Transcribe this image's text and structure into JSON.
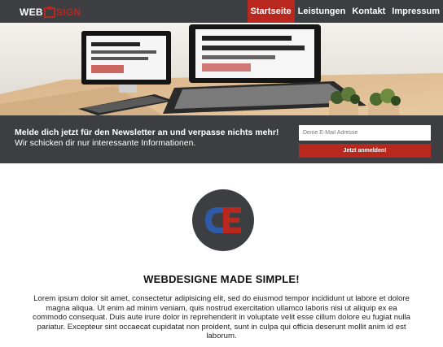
{
  "header": {
    "logo": {
      "left_text": "WEB",
      "right_text": "SIGN"
    },
    "nav": [
      {
        "label": "Startseite",
        "active": true
      },
      {
        "label": "Leistungen",
        "active": false
      },
      {
        "label": "Kontakt",
        "active": false
      },
      {
        "label": "Impressum",
        "active": false
      }
    ]
  },
  "hero": {
    "image": "desk-with-laptop-and-plants"
  },
  "newsletter": {
    "headline": "Melde dich jetzt für den Newsletter an und verpasse nichts mehr!",
    "subtext": " Wir schicken dir nur interessante Informationen.",
    "email_placeholder": "Deine E-Mail Adresse",
    "submit_label": "Jetzt anmelden!"
  },
  "content": {
    "headline": "WEBDESIGNE MADE SIMPLE!",
    "body": "Lorem ipsum dolor sit amet, consectetur adipisicing elit, sed do eiusmod tempor incididunt ut labore et dolore magna aliqua. Ut enim ad minim veniam, quis nostrud exercitation ullamco laboris nisi ut aliquip ex ea commodo consequat. Duis aute irure dolor in reprehenderit in voluptate velit esse cillum dolore eu fugiat nulla pariatur. Excepteur sint occaecat cupidatat non proident, sunt in culpa qui officia deserunt mollit anim id est laborum."
  },
  "colors": {
    "dark": "#3d3e42",
    "accent": "#b9281f",
    "blue": "#2f5aa8"
  }
}
